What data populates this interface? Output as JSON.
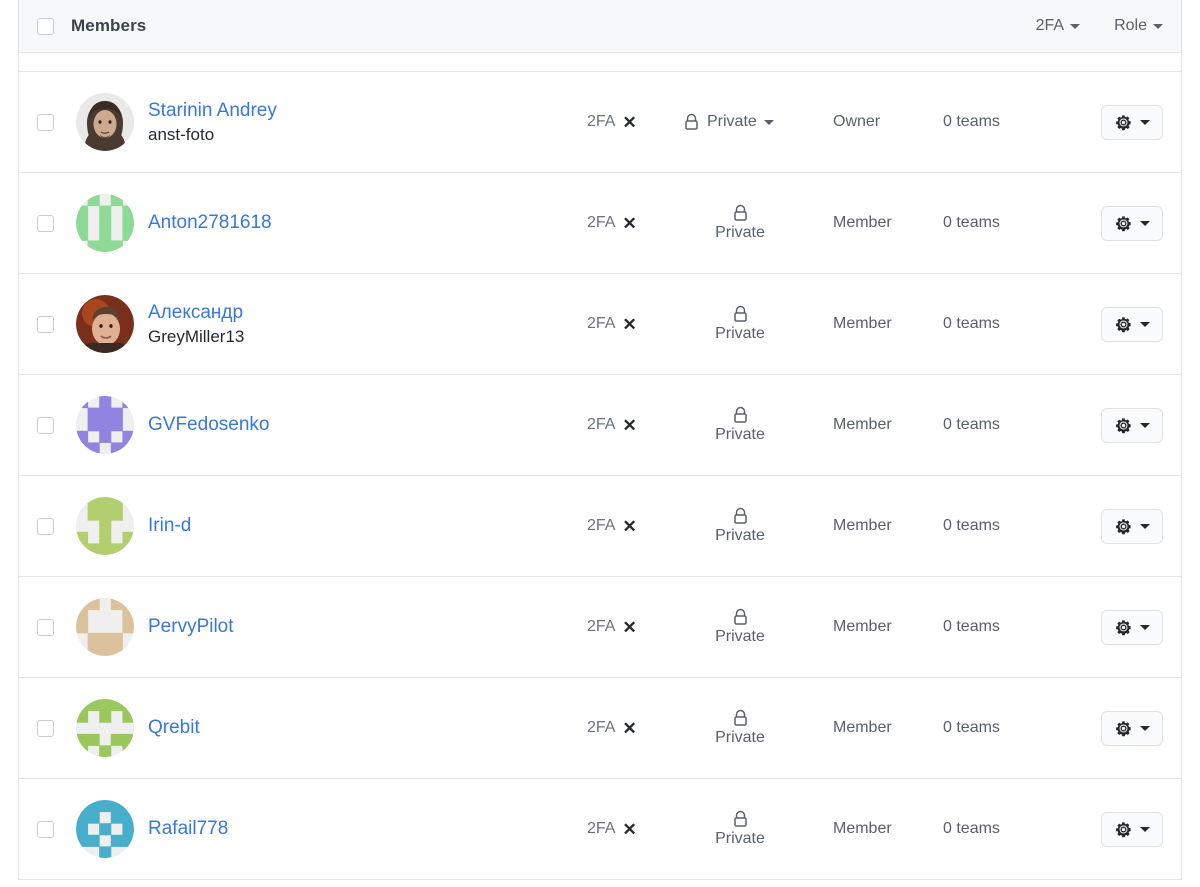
{
  "header": {
    "title": "Members",
    "select_all_checkbox": "unchecked",
    "filters": [
      {
        "label": "2FA",
        "icon": "chevron-down-icon"
      },
      {
        "label": "Role",
        "icon": "chevron-down-icon"
      }
    ]
  },
  "colors": {
    "link": "#3878d6",
    "muted": "#586069",
    "border": "#e1e4e8",
    "header_bg": "#f6f8fa",
    "button_bg": "#fafbfc"
  },
  "row_defaults": {
    "twofa_label": "2FA",
    "twofa_status_icon": "x-icon",
    "visibility_label": "Private",
    "visibility_icon": "lock-icon",
    "teams_label": "0 teams",
    "actions_icon": "gear-icon",
    "actions_caret": "chevron-down-icon"
  },
  "members": [
    {
      "name": "Starinin Andrey",
      "login": "anst-foto",
      "twofa": "2FA",
      "visibility": "Private",
      "visibility_has_caret": true,
      "role": "Owner",
      "teams": "0 teams",
      "avatar_type": "photo"
    },
    {
      "name": "Anton2781618",
      "login": "",
      "twofa": "2FA",
      "visibility": "Private",
      "visibility_has_caret": false,
      "role": "Member",
      "teams": "0 teams",
      "avatar_type": "identicon",
      "avatar_color": "#8ed995",
      "avatar_seed": 2
    },
    {
      "name": "Александр",
      "login": "GreyMiller13",
      "twofa": "2FA",
      "visibility": "Private",
      "visibility_has_caret": false,
      "role": "Member",
      "teams": "0 teams",
      "avatar_type": "photo2"
    },
    {
      "name": "GVFedosenko",
      "login": "",
      "twofa": "2FA",
      "visibility": "Private",
      "visibility_has_caret": false,
      "role": "Member",
      "teams": "0 teams",
      "avatar_type": "identicon",
      "avatar_color": "#9183e0",
      "avatar_seed": 4
    },
    {
      "name": "Irin-d",
      "login": "",
      "twofa": "2FA",
      "visibility": "Private",
      "visibility_has_caret": false,
      "role": "Member",
      "teams": "0 teams",
      "avatar_type": "identicon",
      "avatar_color": "#b3ce6e",
      "avatar_seed": 5
    },
    {
      "name": "PervyPilot",
      "login": "",
      "twofa": "2FA",
      "visibility": "Private",
      "visibility_has_caret": false,
      "role": "Member",
      "teams": "0 teams",
      "avatar_type": "identicon",
      "avatar_color": "#dcc29c",
      "avatar_seed": 6
    },
    {
      "name": "Qrebit",
      "login": "",
      "twofa": "2FA",
      "visibility": "Private",
      "visibility_has_caret": false,
      "role": "Member",
      "teams": "0 teams",
      "avatar_type": "identicon",
      "avatar_color": "#9bc75f",
      "avatar_seed": 7
    },
    {
      "name": "Rafail778",
      "login": "",
      "twofa": "2FA",
      "visibility": "Private",
      "visibility_has_caret": false,
      "role": "Member",
      "teams": "0 teams",
      "avatar_type": "identicon",
      "avatar_color": "#47aecb",
      "avatar_seed": 8
    }
  ]
}
